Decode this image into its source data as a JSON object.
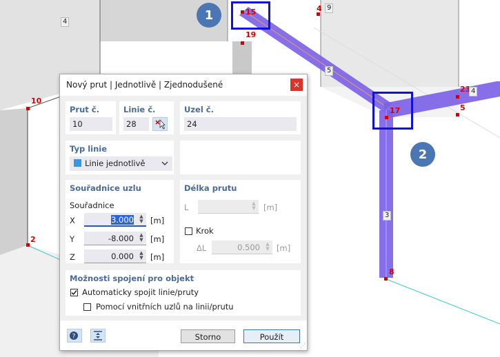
{
  "scene": {
    "node_labels": [
      "15",
      "19",
      "4",
      "10",
      "2",
      "17",
      "23",
      "5",
      "8"
    ],
    "member_labels": [
      "4",
      "9",
      "5",
      "3",
      "4"
    ],
    "callouts": [
      "1",
      "2"
    ]
  },
  "dialog": {
    "title": "Nový prut | Jednotlivě | Zjednodušené",
    "close_symbol": "×",
    "member_no_label": "Prut č.",
    "member_no": "10",
    "line_no_label": "Linie č.",
    "line_no": "28",
    "node_no_label": "Uzel č.",
    "node_no": "24",
    "line_type_label": "Typ linie",
    "line_type_value": "Linie jednotlivě",
    "line_type_color": "#3399e6",
    "node_coords_label": "Souřadnice uzlu",
    "coords_sub_label": "Souřadnice",
    "x_label": "X",
    "x_value": "3.000",
    "y_label": "Y",
    "y_value": "-8.000",
    "z_label": "Z",
    "z_value": "0.000",
    "unit_m": "[m]",
    "length_label": "Délka prutu",
    "l_label": "L",
    "l_value": "",
    "step_label": "Krok",
    "dl_label": "ΔL",
    "dl_value": "0.500",
    "connect_label": "Možnosti spojení pro objekt",
    "auto_connect_label": "Automaticky spojit linie/pruty",
    "auto_connect_checked": true,
    "internal_nodes_label": "Pomocí vnitřních uzlů na linii/prutu",
    "internal_nodes_checked": false,
    "cancel_label": "Storno",
    "apply_label": "Použít"
  }
}
